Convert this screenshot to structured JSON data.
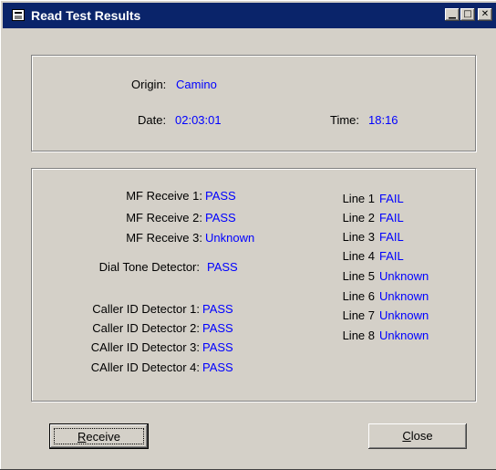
{
  "window": {
    "title": "Read Test Results"
  },
  "titlebar_buttons": {
    "minimize": "▁",
    "maximize": "□",
    "close": "✕"
  },
  "info": {
    "origin_label": "Origin:",
    "origin_value": "Camino",
    "date_label": "Date:",
    "date_value": "02:03:01",
    "time_label": "Time:",
    "time_value": "18:16"
  },
  "results": {
    "mf": [
      {
        "label": "MF Receive 1:",
        "value": "PASS"
      },
      {
        "label": "MF Receive 2:",
        "value": "PASS"
      },
      {
        "label": "MF Receive 3:",
        "value": "Unknown"
      }
    ],
    "dial_tone": {
      "label": "Dial Tone Detector:",
      "value": "PASS"
    },
    "caller_id": [
      {
        "label": "Caller ID Detector 1:",
        "value": "PASS"
      },
      {
        "label": "Caller ID Detector 2:",
        "value": "PASS"
      },
      {
        "label": "CAller ID Detector 3:",
        "value": "PASS"
      },
      {
        "label": "CAller ID Detector 4:",
        "value": "PASS"
      }
    ],
    "lines": [
      {
        "label": "Line 1",
        "value": "FAIL"
      },
      {
        "label": "Line 2",
        "value": "FAIL"
      },
      {
        "label": "Line 3",
        "value": "FAIL"
      },
      {
        "label": "Line 4",
        "value": "FAIL"
      },
      {
        "label": "Line 5",
        "value": "Unknown"
      },
      {
        "label": "Line 6",
        "value": "Unknown"
      },
      {
        "label": "Line 7",
        "value": "Unknown"
      },
      {
        "label": "Line 8",
        "value": "Unknown"
      }
    ]
  },
  "buttons": {
    "receive": {
      "mnemonic": "R",
      "rest": "eceive"
    },
    "close": {
      "mnemonic": "C",
      "rest": "lose"
    }
  },
  "colors": {
    "value_text": "#0000ff",
    "titlebar": "#0a246a",
    "face": "#d4d0c8"
  }
}
